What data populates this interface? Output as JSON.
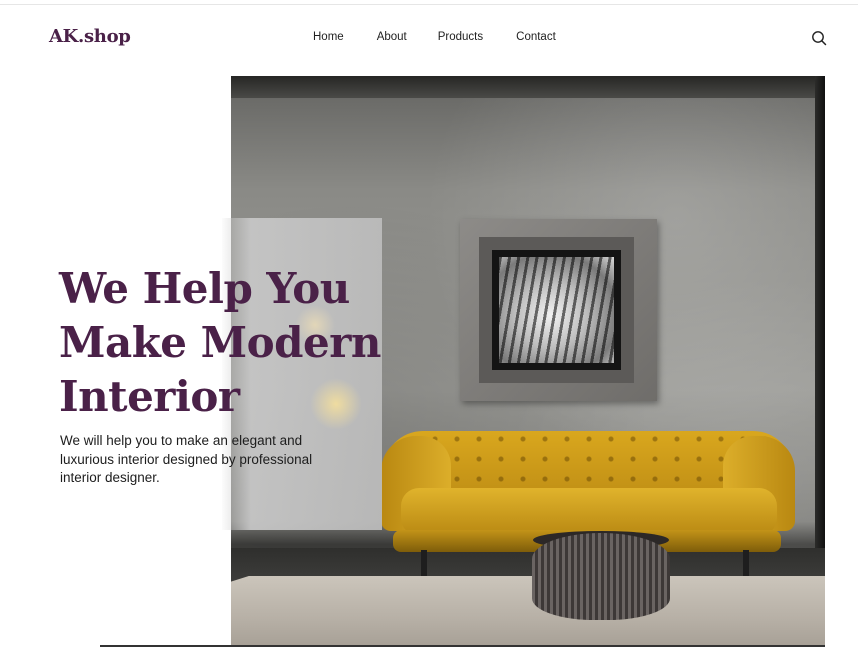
{
  "header": {
    "logo": "AK.shop",
    "nav": [
      "Home",
      "About",
      "Products",
      "Contact"
    ],
    "search_icon": "search-icon"
  },
  "hero": {
    "title_lines": [
      "We Help You",
      "Make Modern",
      "Interior"
    ],
    "description": "We will help you to make an elegant and luxurious interior designed by professional interior designer."
  },
  "colors": {
    "brand": "#4a2148",
    "sofa": "#d4a21c"
  }
}
